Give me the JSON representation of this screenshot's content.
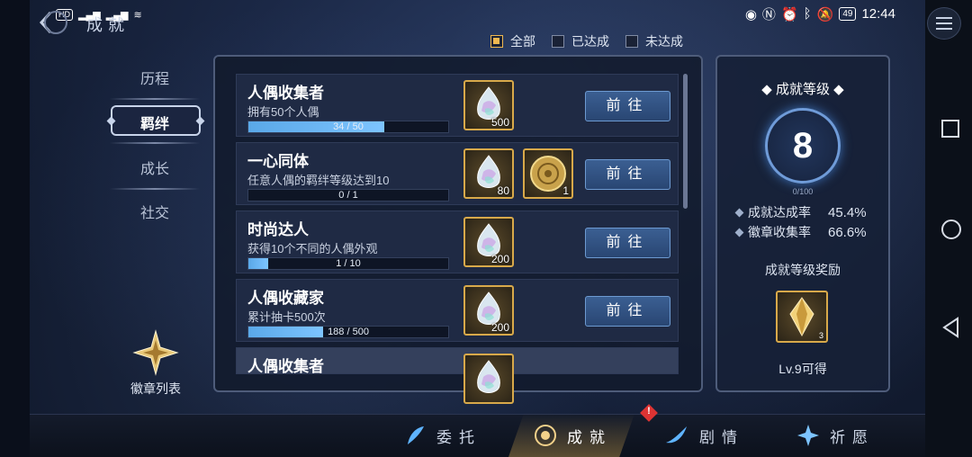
{
  "status": {
    "left_icons": "HD 2 4G 4G wifi",
    "battery": "49",
    "time": "12:44"
  },
  "page": {
    "title": "成就"
  },
  "filters": [
    {
      "label": "全部",
      "checked": true
    },
    {
      "label": "已达成",
      "checked": false
    },
    {
      "label": "未达成",
      "checked": false
    }
  ],
  "left_tabs": [
    {
      "label": "历程",
      "active": false
    },
    {
      "label": "羁绊",
      "active": true
    },
    {
      "label": "成长",
      "active": false
    },
    {
      "label": "社交",
      "active": false
    }
  ],
  "badge_list": {
    "label": "徽章列表"
  },
  "achievements": [
    {
      "title": "人偶收集者",
      "desc": "拥有50个人偶",
      "progress_text": "34 / 50",
      "progress": 0.68,
      "rewards": [
        {
          "icon": "crystal-icon",
          "count": "500"
        }
      ],
      "button": "前往"
    },
    {
      "title": "一心同体",
      "desc": "任意人偶的羁绊等级达到10",
      "progress_text": "0 / 1",
      "progress": 0.0,
      "rewards": [
        {
          "icon": "crystal-icon",
          "count": "80"
        },
        {
          "icon": "coin-icon",
          "count": "1"
        }
      ],
      "button": "前往"
    },
    {
      "title": "时尚达人",
      "desc": "获得10个不同的人偶外观",
      "progress_text": "1 / 10",
      "progress": 0.1,
      "rewards": [
        {
          "icon": "crystal-icon",
          "count": "200"
        }
      ],
      "button": "前往"
    },
    {
      "title": "人偶收藏家",
      "desc": "累计抽卡500次",
      "progress_text": "188 / 500",
      "progress": 0.376,
      "rewards": [
        {
          "icon": "crystal-icon",
          "count": "200"
        }
      ],
      "button": "前往"
    },
    {
      "title": "人偶收集者",
      "desc": "",
      "progress_text": "",
      "progress": 0,
      "rewards": [
        {
          "icon": "crystal-icon",
          "count": ""
        }
      ],
      "button": ""
    }
  ],
  "level_panel": {
    "title": "成就等级",
    "level": "8",
    "exp_text": "0/100",
    "stats": [
      {
        "label": "成就达成率",
        "value": "45.4%"
      },
      {
        "label": "徽章收集率",
        "value": "66.6%"
      }
    ],
    "reward_label": "成就等级奖励",
    "reward_count": "3",
    "reward_unlock": "Lv.9可得"
  },
  "bottom_tabs": [
    {
      "label": "委托",
      "active": false
    },
    {
      "label": "成就",
      "active": true
    },
    {
      "label": "剧情",
      "active": false
    },
    {
      "label": "祈愿",
      "active": false
    }
  ],
  "alert_mark": "!",
  "colors": {
    "accent": "#f0b850",
    "button": "#3b5f92",
    "progress": "#6bb6f5"
  }
}
